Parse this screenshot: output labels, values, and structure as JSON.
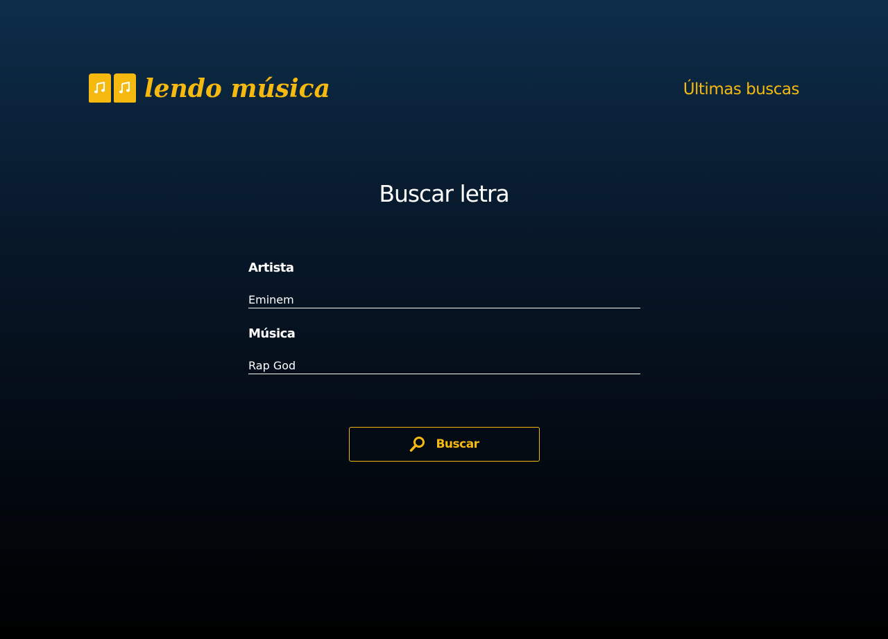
{
  "header": {
    "logo_text": "lendo música",
    "logo_icon": "music-book-icon",
    "nav_link": "Últimas buscas"
  },
  "main": {
    "title": "Buscar letra",
    "fields": [
      {
        "label": "Artista",
        "value": "Eminem"
      },
      {
        "label": "Música",
        "value": "Rap God"
      }
    ],
    "search_button": {
      "label": "Buscar",
      "icon": "search-icon"
    }
  },
  "colors": {
    "accent": "#f5b90f",
    "text": "#ffffff",
    "background_top": "#0d2d4a",
    "background_bottom": "#000000"
  }
}
